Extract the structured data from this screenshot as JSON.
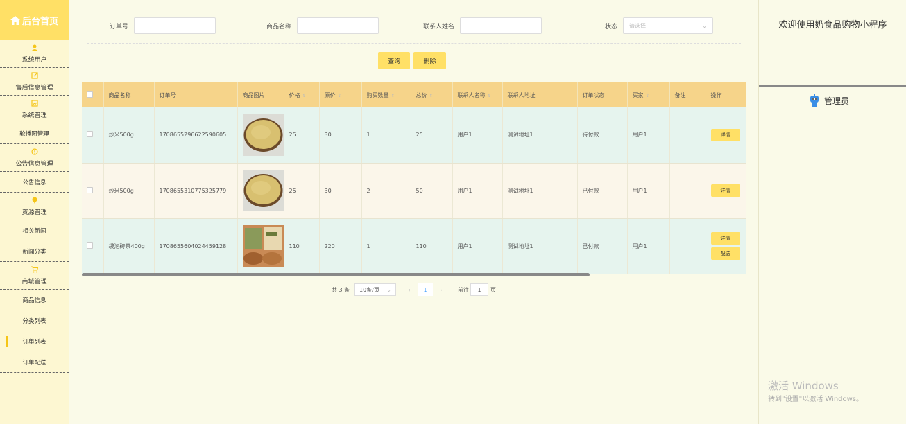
{
  "sidebar": {
    "brand": "后台首页",
    "items": [
      {
        "type": "head",
        "label": "系统用户",
        "icon": "user-icon"
      },
      {
        "type": "head",
        "label": "售后信息管理",
        "icon": "edit-icon"
      },
      {
        "type": "head",
        "label": "系统管理",
        "icon": "image-icon"
      },
      {
        "type": "sub",
        "label": "轮播图管理"
      },
      {
        "type": "head",
        "label": "公告信息管理",
        "icon": "info-icon"
      },
      {
        "type": "sub",
        "label": "公告信息"
      },
      {
        "type": "head",
        "label": "资源管理",
        "icon": "pin-icon"
      },
      {
        "type": "sub",
        "label": "相关新闻"
      },
      {
        "type": "sub",
        "label": "新闻分类"
      },
      {
        "type": "head",
        "label": "商城管理",
        "icon": "cart-icon"
      },
      {
        "type": "sub",
        "label": "商品信息"
      },
      {
        "type": "sub",
        "label": "分类列表"
      },
      {
        "type": "sub",
        "label": "订单列表",
        "active": true
      },
      {
        "type": "sub",
        "label": "订单配送"
      }
    ]
  },
  "filters": {
    "order_no_label": "订单号",
    "product_name_label": "商品名称",
    "contact_name_label": "联系人姓名",
    "status_label": "状态",
    "status_placeholder": "请选择",
    "search_button": "查询",
    "delete_button": "删除"
  },
  "table": {
    "headers": [
      "商品名称",
      "订单号",
      "商品图片",
      "价格",
      "原价",
      "购买数量",
      "总价",
      "联系人名称",
      "联系人地址",
      "订单状态",
      "买家",
      "备注",
      "操作"
    ],
    "rows": [
      {
        "name": "炒米500g",
        "order_no": "1708655296622590605",
        "image": "millet",
        "price": "25",
        "orig_price": "30",
        "qty": "1",
        "total": "25",
        "contact": "用户1",
        "address": "测试地址1",
        "status": "待付款",
        "buyer": "用户1",
        "remark": "",
        "ops": [
          "详情"
        ]
      },
      {
        "name": "炒米500g",
        "order_no": "1708655310775325779",
        "image": "millet",
        "price": "25",
        "orig_price": "30",
        "qty": "2",
        "total": "50",
        "contact": "用户1",
        "address": "测试地址1",
        "status": "已付款",
        "buyer": "用户1",
        "remark": "",
        "ops": [
          "详情"
        ]
      },
      {
        "name": "袋泡砖茶400g",
        "order_no": "1708655604024459128",
        "image": "tea",
        "price": "110",
        "orig_price": "220",
        "qty": "1",
        "total": "110",
        "contact": "用户1",
        "address": "测试地址1",
        "status": "已付款",
        "buyer": "用户1",
        "remark": "",
        "ops": [
          "详情",
          "配送"
        ]
      }
    ]
  },
  "pager": {
    "total": "共 3 条",
    "page_size": "10条/页",
    "current": "1",
    "goto_label": "前往",
    "goto_value": "1",
    "page_unit": "页"
  },
  "right_panel": {
    "welcome": "欢迎使用奶食品购物小程序",
    "role": "管理员",
    "watermark_title": "激活 Windows",
    "watermark_sub": "转到\"设置\"以激活 Windows。"
  },
  "colors": {
    "accent": "#ffe066",
    "header": "#f6d48a",
    "row_alt": "#e6f4ee"
  }
}
